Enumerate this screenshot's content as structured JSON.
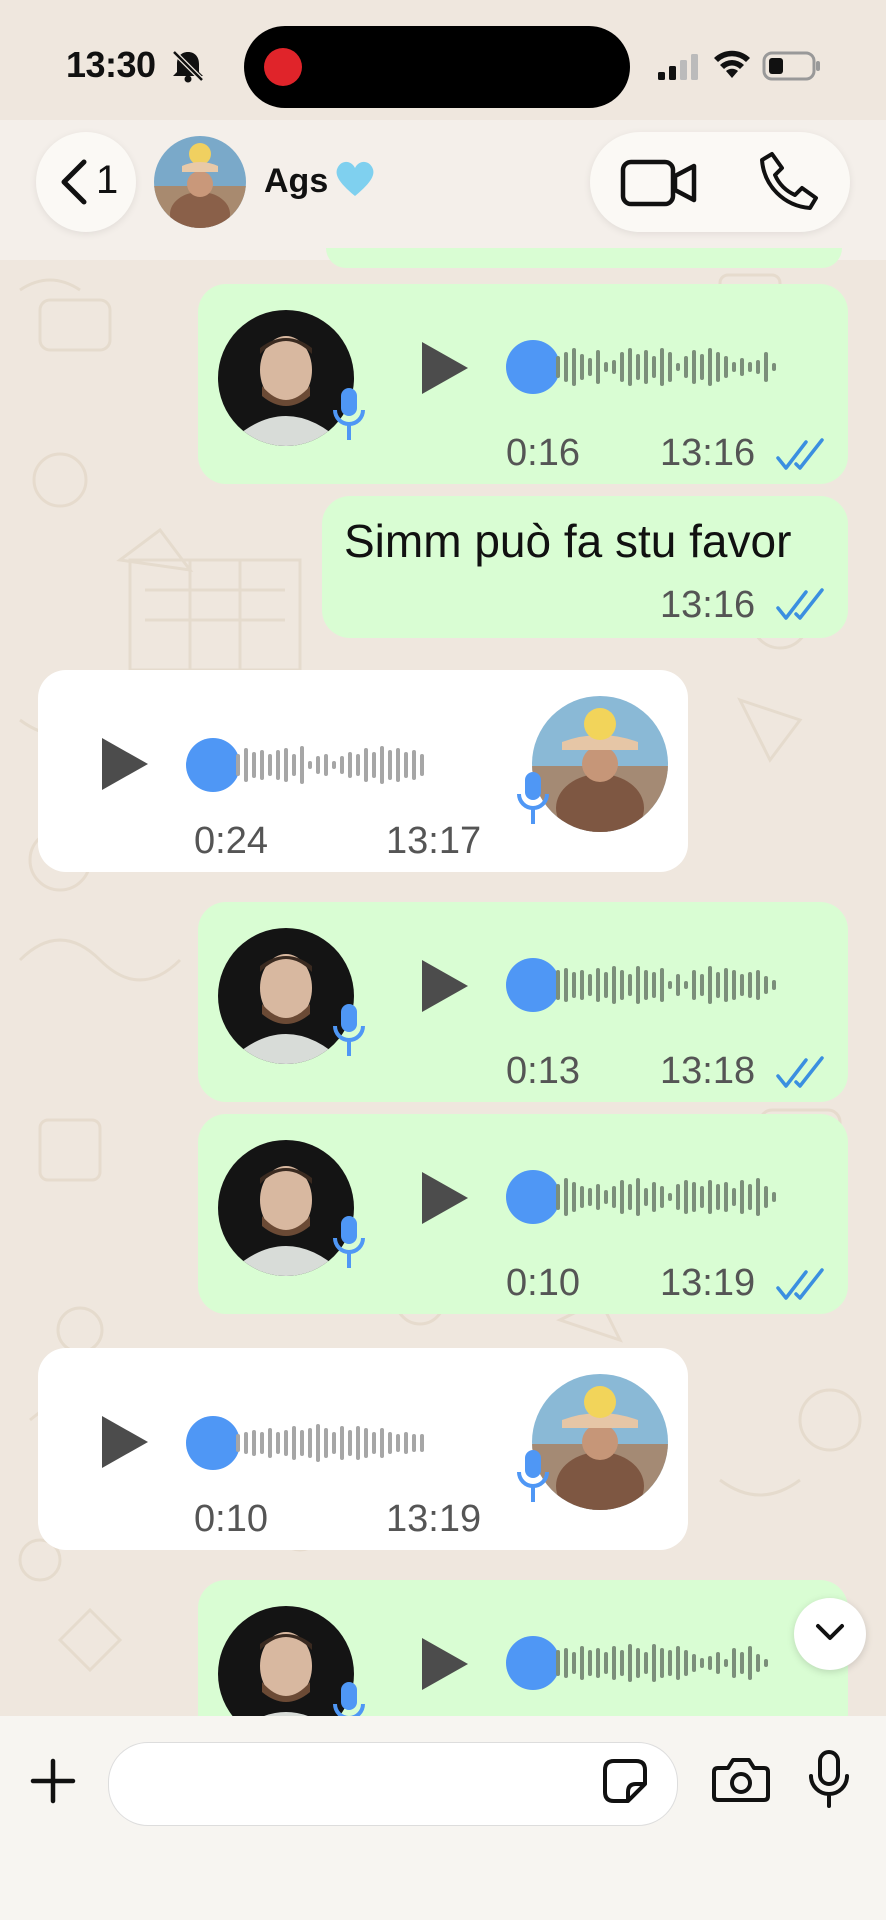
{
  "status_bar": {
    "time": "13:30",
    "icons": [
      "bell-slash-icon",
      "signal-icon",
      "wifi-icon",
      "battery-icon"
    ],
    "recording_indicator": "red-dot"
  },
  "header": {
    "back_count": "1",
    "contact_name": "Ags",
    "name_emoji": "light-blue-heart-icon",
    "actions": [
      "video-call-icon",
      "voice-call-icon"
    ]
  },
  "messages": [
    {
      "type": "voice",
      "direction": "outgoing",
      "duration": "0:16",
      "time": "13:16",
      "read": true,
      "progress": 0
    },
    {
      "type": "text",
      "direction": "outgoing",
      "text": "Simm può fa stu favor",
      "time": "13:16",
      "read": true
    },
    {
      "type": "voice",
      "direction": "incoming",
      "duration": "0:24",
      "time": "13:17",
      "progress": 0
    },
    {
      "type": "voice",
      "direction": "outgoing",
      "duration": "0:13",
      "time": "13:18",
      "read": true,
      "progress": 0
    },
    {
      "type": "voice",
      "direction": "outgoing",
      "duration": "0:10",
      "time": "13:19",
      "read": true,
      "progress": 0
    },
    {
      "type": "voice",
      "direction": "incoming",
      "duration": "0:10",
      "time": "13:19",
      "progress": 0
    },
    {
      "type": "voice",
      "direction": "outgoing",
      "duration": "",
      "time": "",
      "progress": 0
    }
  ],
  "input": {
    "placeholder": "",
    "icons": [
      "plus-icon",
      "sticker-icon",
      "camera-icon",
      "microphone-icon"
    ]
  },
  "colors": {
    "outgoing_bubble": "#d9fdd3",
    "incoming_bubble": "#ffffff",
    "chat_background": "#efe7de",
    "accent_blue": "#4f97f5",
    "read_ticks": "#3b8fe0"
  }
}
